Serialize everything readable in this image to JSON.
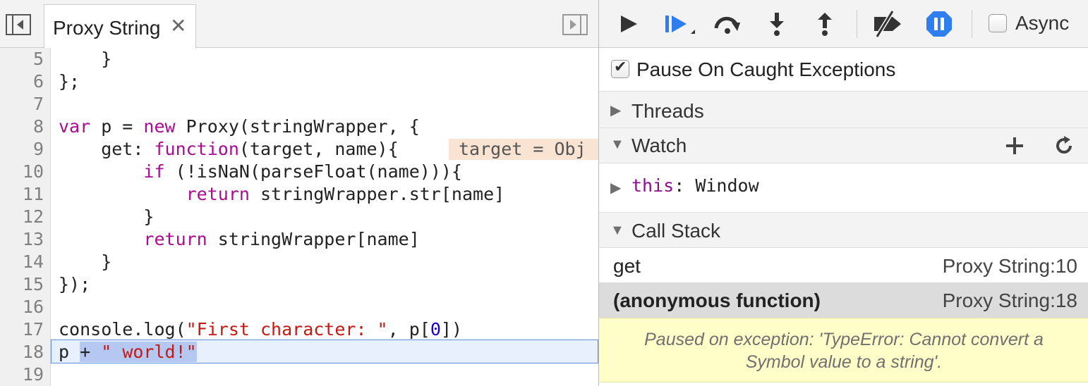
{
  "tab": {
    "label": "Proxy String",
    "close_glyph": "✕"
  },
  "code": {
    "line_numbers": [
      "5",
      "6",
      "7",
      "8",
      "9",
      "10",
      "11",
      "12",
      "13",
      "14",
      "15",
      "16",
      "17",
      "18",
      "19"
    ],
    "inline_value": "target = Obj",
    "current_line": "18"
  },
  "toolbar": {
    "icons": [
      "play-icon",
      "step-into-debugger-icon",
      "step-over-icon",
      "step-in-icon",
      "step-out-icon",
      "deactivate-breakpoints-icon",
      "pause-on-exceptions-icon"
    ],
    "async_label": "Async",
    "async_checked": false,
    "accent_color": "#2e7ef0"
  },
  "pause_caught": {
    "label": "Pause On Caught Exceptions",
    "checked": true
  },
  "sections": {
    "threads": "Threads",
    "watch": "Watch",
    "call_stack": "Call Stack"
  },
  "watch": {
    "items": [
      {
        "name": "this",
        "sep": ": ",
        "value": "Window"
      }
    ]
  },
  "call_stack": {
    "frames": [
      {
        "name": "get",
        "location": "Proxy String:10",
        "selected": false
      },
      {
        "name": "(anonymous function)",
        "location": "Proxy String:18",
        "selected": true
      }
    ]
  },
  "exception": {
    "message": "Paused on exception: 'TypeError: Cannot convert a Symbol value to a string'."
  }
}
